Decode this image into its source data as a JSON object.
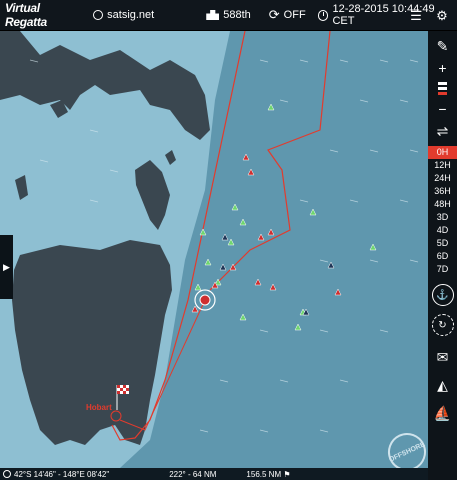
{
  "topbar": {
    "logo": "Virtual Regatta",
    "site": "satsig.net",
    "rank": "588th",
    "sync_status": "OFF",
    "datetime": "12-28-2015 10:44:49 CET"
  },
  "map": {
    "city_label": "Hobart",
    "badge_text": "OFFSHORE",
    "colors": {
      "land": "#3a4750",
      "sea_deep": "#5f97ae",
      "sea_shallow": "#8ebfd2",
      "route": "#e23b2d",
      "boat_green": "#6fd66f",
      "boat_red": "#cf2f2f",
      "boat_navy": "#1f3556"
    }
  },
  "sidebar": {
    "time_options": [
      "0H",
      "12H",
      "24H",
      "36H",
      "48H",
      "3D",
      "4D",
      "5D",
      "6D",
      "7D"
    ],
    "active_time": "0H",
    "icons": [
      "compose-icon",
      "zoom-in-icon",
      "zoom-out-icon",
      "filter-icon",
      "crew-icon",
      "route-icon",
      "mail-icon",
      "boat-icon"
    ]
  },
  "bottombar": {
    "position": "42°S 14'46\" - 148°E 08'42\"",
    "heading": "222° - 64 NM",
    "distance": "156.5 NM"
  }
}
